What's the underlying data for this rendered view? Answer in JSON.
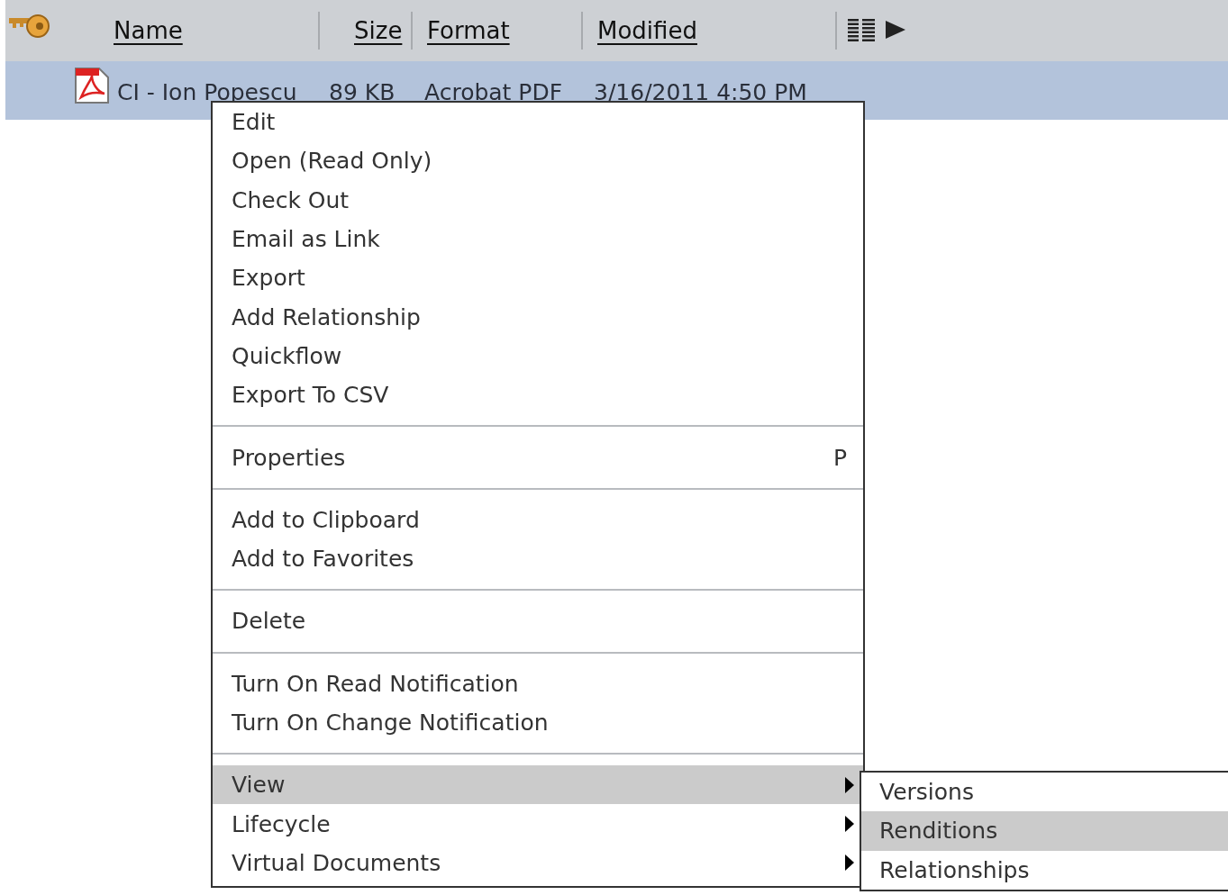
{
  "table": {
    "columns": [
      {
        "label": "Name"
      },
      {
        "label": "Size"
      },
      {
        "label": "Format"
      },
      {
        "label": "Modified"
      }
    ],
    "rows": [
      {
        "selected": true,
        "cells": [
          "CI - Ion Popescu",
          "89 KB",
          "Acrobat PDF",
          "3/16/2011 4:50 PM"
        ]
      }
    ]
  },
  "context_menu": {
    "groups": [
      {
        "items": [
          {
            "label": "Edit",
            "selected": false
          },
          {
            "label": "Open (Read Only)",
            "selected": false
          },
          {
            "label": "Check Out",
            "selected": false
          },
          {
            "label": "Email as Link",
            "selected": false
          },
          {
            "label": "Export",
            "selected": false
          },
          {
            "label": "Add Relationship",
            "selected": false
          },
          {
            "label": "Quickflow",
            "selected": false
          },
          {
            "label": "Export To CSV",
            "selected": false
          }
        ]
      },
      {
        "items": [
          {
            "label": "Properties",
            "shortcut": "P",
            "selected": false
          }
        ]
      },
      {
        "items": [
          {
            "label": "Add to Clipboard",
            "selected": false
          },
          {
            "label": "Add to Favorites",
            "selected": false
          }
        ]
      },
      {
        "items": [
          {
            "label": "Delete",
            "selected": false
          }
        ]
      },
      {
        "items": [
          {
            "label": "Turn On Read Notification",
            "selected": false
          },
          {
            "label": "Turn On Change Notification",
            "selected": false
          }
        ]
      },
      {
        "items": [
          {
            "label": "View",
            "submenu": true,
            "selected": true
          },
          {
            "label": "Lifecycle",
            "submenu": true,
            "selected": false
          },
          {
            "label": "Virtual Documents",
            "submenu": true,
            "selected": false
          }
        ]
      }
    ]
  },
  "submenu": {
    "items": [
      {
        "label": "Versions",
        "selected": false
      },
      {
        "label": "Renditions",
        "selected": true
      },
      {
        "label": "Relationships",
        "selected": false
      }
    ]
  }
}
